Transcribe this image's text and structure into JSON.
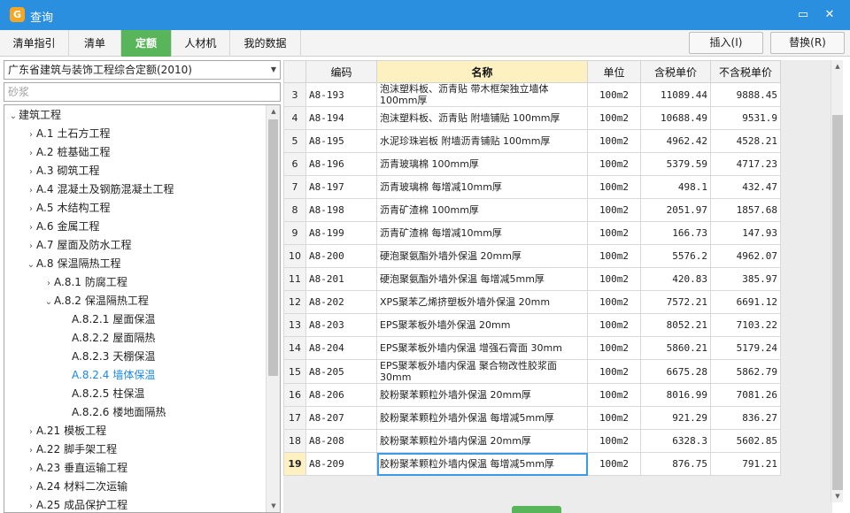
{
  "window": {
    "title": "查询",
    "logo_text": "G",
    "minimize_glyph": "▭",
    "close_glyph": "✕"
  },
  "tabs": [
    {
      "label": "清单指引",
      "active": false
    },
    {
      "label": "清单",
      "active": false
    },
    {
      "label": "定额",
      "active": true
    },
    {
      "label": "人材机",
      "active": false
    },
    {
      "label": "我的数据",
      "active": false
    }
  ],
  "actions": {
    "insert": "插入(I)",
    "replace": "替换(R)"
  },
  "colors": {
    "titlebar": "#2b8fe0",
    "active_tab": "#59b559",
    "highlight": "#fdf0c1",
    "selected_tree": "#1a88e0"
  },
  "left": {
    "dataset": "广东省建筑与装饰工程综合定额(2010)",
    "search_placeholder": "砂浆",
    "tree": [
      {
        "code": "",
        "label": "建筑工程",
        "level": 0,
        "toggle": "expanded"
      },
      {
        "code": "A.1",
        "label": "土石方工程",
        "level": 1,
        "toggle": "collapsed"
      },
      {
        "code": "A.2",
        "label": "桩基础工程",
        "level": 1,
        "toggle": "collapsed"
      },
      {
        "code": "A.3",
        "label": "砌筑工程",
        "level": 1,
        "toggle": "collapsed"
      },
      {
        "code": "A.4",
        "label": "混凝土及钢筋混凝土工程",
        "level": 1,
        "toggle": "collapsed"
      },
      {
        "code": "A.5",
        "label": "木结构工程",
        "level": 1,
        "toggle": "collapsed"
      },
      {
        "code": "A.6",
        "label": "金属工程",
        "level": 1,
        "toggle": "collapsed"
      },
      {
        "code": "A.7",
        "label": "屋面及防水工程",
        "level": 1,
        "toggle": "collapsed"
      },
      {
        "code": "A.8",
        "label": "保温隔热工程",
        "level": 1,
        "toggle": "expanded"
      },
      {
        "code": "A.8.1",
        "label": "防腐工程",
        "level": 2,
        "toggle": "collapsed"
      },
      {
        "code": "A.8.2",
        "label": "保温隔热工程",
        "level": 2,
        "toggle": "expanded"
      },
      {
        "code": "A.8.2.1",
        "label": "屋面保温",
        "level": 3,
        "toggle": "none"
      },
      {
        "code": "A.8.2.2",
        "label": "屋面隔热",
        "level": 3,
        "toggle": "none"
      },
      {
        "code": "A.8.2.3",
        "label": "天棚保温",
        "level": 3,
        "toggle": "none"
      },
      {
        "code": "A.8.2.4",
        "label": "墙体保温",
        "level": 3,
        "toggle": "none",
        "selected": true
      },
      {
        "code": "A.8.2.5",
        "label": "柱保温",
        "level": 3,
        "toggle": "none"
      },
      {
        "code": "A.8.2.6",
        "label": "楼地面隔热",
        "level": 3,
        "toggle": "none"
      },
      {
        "code": "A.21",
        "label": "模板工程",
        "level": 1,
        "toggle": "collapsed"
      },
      {
        "code": "A.22",
        "label": "脚手架工程",
        "level": 1,
        "toggle": "collapsed"
      },
      {
        "code": "A.23",
        "label": "垂直运输工程",
        "level": 1,
        "toggle": "collapsed"
      },
      {
        "code": "A.24",
        "label": "材料二次运输",
        "level": 1,
        "toggle": "collapsed"
      },
      {
        "code": "A.25",
        "label": "成品保护工程",
        "level": 1,
        "toggle": "collapsed"
      }
    ]
  },
  "grid": {
    "headers": {
      "row_no": "",
      "code": "编码",
      "name": "名称",
      "unit": "单位",
      "price_tax": "含税单价",
      "price_notax": "不含税单价"
    },
    "rows": [
      {
        "no": "3",
        "code": "A8-193",
        "name": "泡沫塑料板、沥青贴 带木框架独立墙体 100mm厚",
        "unit": "100m2",
        "price_tax": "11089.44",
        "price_notax": "9888.45"
      },
      {
        "no": "4",
        "code": "A8-194",
        "name": "泡沫塑料板、沥青贴 附墙铺贴 100mm厚",
        "unit": "100m2",
        "price_tax": "10688.49",
        "price_notax": "9531.9"
      },
      {
        "no": "5",
        "code": "A8-195",
        "name": "水泥珍珠岩板 附墙沥青铺贴 100mm厚",
        "unit": "100m2",
        "price_tax": "4962.42",
        "price_notax": "4528.21"
      },
      {
        "no": "6",
        "code": "A8-196",
        "name": "沥青玻璃棉 100mm厚",
        "unit": "100m2",
        "price_tax": "5379.59",
        "price_notax": "4717.23"
      },
      {
        "no": "7",
        "code": "A8-197",
        "name": "沥青玻璃棉 每增减10mm厚",
        "unit": "100m2",
        "price_tax": "498.1",
        "price_notax": "432.47"
      },
      {
        "no": "8",
        "code": "A8-198",
        "name": "沥青矿渣棉 100mm厚",
        "unit": "100m2",
        "price_tax": "2051.97",
        "price_notax": "1857.68"
      },
      {
        "no": "9",
        "code": "A8-199",
        "name": "沥青矿渣棉 每增减10mm厚",
        "unit": "100m2",
        "price_tax": "166.73",
        "price_notax": "147.93"
      },
      {
        "no": "10",
        "code": "A8-200",
        "name": "硬泡聚氨酯外墙外保温 20mm厚",
        "unit": "100m2",
        "price_tax": "5576.2",
        "price_notax": "4962.07"
      },
      {
        "no": "11",
        "code": "A8-201",
        "name": "硬泡聚氨酯外墙外保温 每增减5mm厚",
        "unit": "100m2",
        "price_tax": "420.83",
        "price_notax": "385.97"
      },
      {
        "no": "12",
        "code": "A8-202",
        "name": "XPS聚苯乙烯挤塑板外墙外保温 20mm",
        "unit": "100m2",
        "price_tax": "7572.21",
        "price_notax": "6691.12"
      },
      {
        "no": "13",
        "code": "A8-203",
        "name": "EPS聚苯板外墙外保温 20mm",
        "unit": "100m2",
        "price_tax": "8052.21",
        "price_notax": "7103.22"
      },
      {
        "no": "14",
        "code": "A8-204",
        "name": "EPS聚苯板外墙内保温 增强石膏面 30mm",
        "unit": "100m2",
        "price_tax": "5860.21",
        "price_notax": "5179.24"
      },
      {
        "no": "15",
        "code": "A8-205",
        "name": "EPS聚苯板外墙内保温 聚合物改性胶浆面 30mm",
        "unit": "100m2",
        "price_tax": "6675.28",
        "price_notax": "5862.79"
      },
      {
        "no": "16",
        "code": "A8-206",
        "name": "胶粉聚苯颗粒外墙外保温 20mm厚",
        "unit": "100m2",
        "price_tax": "8016.99",
        "price_notax": "7081.26"
      },
      {
        "no": "17",
        "code": "A8-207",
        "name": "胶粉聚苯颗粒外墙外保温 每增减5mm厚",
        "unit": "100m2",
        "price_tax": "921.29",
        "price_notax": "836.27"
      },
      {
        "no": "18",
        "code": "A8-208",
        "name": "胶粉聚苯颗粒外墙内保温 20mm厚",
        "unit": "100m2",
        "price_tax": "6328.3",
        "price_notax": "5602.85"
      },
      {
        "no": "19",
        "code": "A8-209",
        "name": "胶粉聚苯颗粒外墙内保温 每增减5mm厚",
        "unit": "100m2",
        "price_tax": "876.75",
        "price_notax": "791.21",
        "current": true
      }
    ]
  }
}
